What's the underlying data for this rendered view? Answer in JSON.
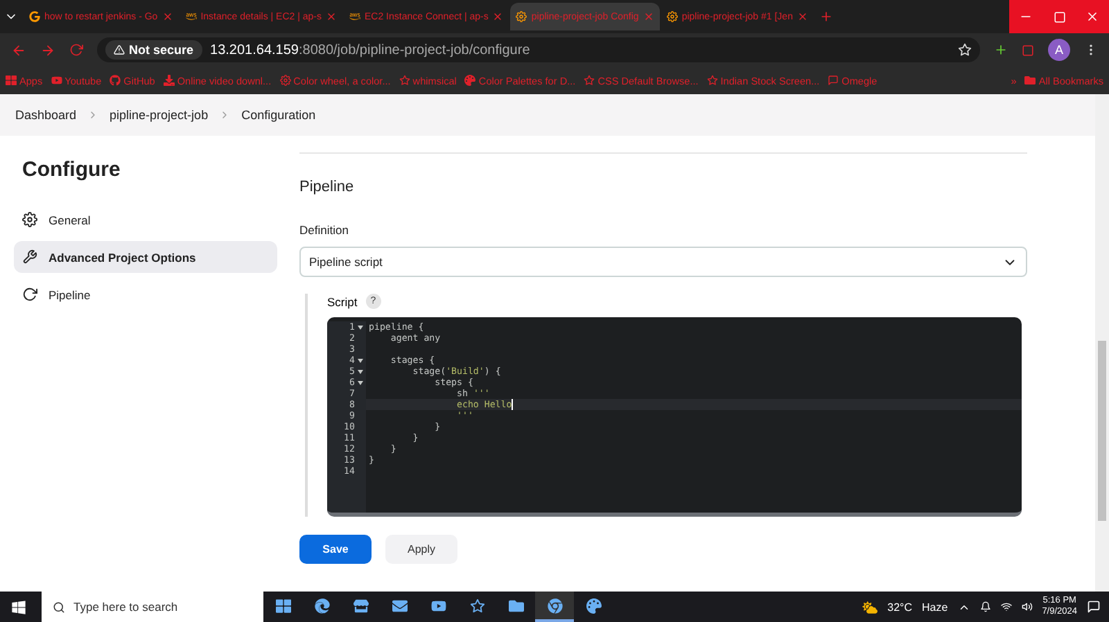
{
  "browser": {
    "tabs": [
      {
        "title": "how to restart jenkins - Go",
        "selected": false
      },
      {
        "title": "Instance details | EC2 | ap-s",
        "selected": false
      },
      {
        "title": "EC2 Instance Connect | ap-s",
        "selected": false
      },
      {
        "title": "pipline-project-job Config",
        "selected": true
      },
      {
        "title": "pipline-project-job #1 [Jen",
        "selected": false
      }
    ],
    "security": "Not secure",
    "url_host": "13.201.64.159",
    "url_path": ":8080/job/pipline-project-job/configure",
    "profile": "A",
    "bookmarks": [
      "Apps",
      "Youtube",
      "GitHub",
      "Online video downl...",
      "Color wheel, a color...",
      "whimsical",
      "Color Palettes for D...",
      "CSS Default Browse...",
      "Indian Stock Screen...",
      "Omegle"
    ],
    "more": "»",
    "all_bookmarks": "All Bookmarks"
  },
  "breadcrumb": [
    "Dashboard",
    "pipline-project-job",
    "Configuration"
  ],
  "sidebar": {
    "title": "Configure",
    "items": [
      {
        "label": "General",
        "selected": false
      },
      {
        "label": "Advanced Project Options",
        "selected": true
      },
      {
        "label": "Pipeline",
        "selected": false
      }
    ]
  },
  "section": {
    "title": "Pipeline",
    "definition_label": "Definition",
    "definition_value": "Pipeline script",
    "script_label": "Script",
    "help": "?",
    "code": [
      {
        "number": "1",
        "foldable": true,
        "active": false,
        "segments": [
          {
            "text": "pipeline {",
            "kind": "plain"
          }
        ]
      },
      {
        "number": "2",
        "foldable": false,
        "active": false,
        "segments": [
          {
            "text": "    agent any",
            "kind": "plain"
          }
        ]
      },
      {
        "number": "3",
        "foldable": false,
        "active": false
      },
      {
        "number": "4",
        "foldable": true,
        "active": false,
        "segments": [
          {
            "text": "    stages {",
            "kind": "plain"
          }
        ]
      },
      {
        "number": "5",
        "foldable": true,
        "active": false,
        "segments": [
          {
            "text": "        stage(",
            "kind": "plain"
          },
          {
            "text": "'Build'",
            "kind": "string"
          },
          {
            "text": ") {",
            "kind": "plain"
          }
        ]
      },
      {
        "number": "6",
        "foldable": true,
        "active": false,
        "segments": [
          {
            "text": "            steps {",
            "kind": "plain"
          }
        ]
      },
      {
        "number": "7",
        "foldable": false,
        "active": false,
        "segments": [
          {
            "text": "                sh ",
            "kind": "plain"
          },
          {
            "text": "'''",
            "kind": "string"
          }
        ]
      },
      {
        "number": "8",
        "foldable": false,
        "active": true,
        "segments": [
          {
            "text": "                echo Hello",
            "kind": "string"
          }
        ]
      },
      {
        "number": "9",
        "foldable": false,
        "active": false,
        "segments": [
          {
            "text": "                '''",
            "kind": "string"
          }
        ]
      },
      {
        "number": "10",
        "foldable": false,
        "active": false,
        "segments": [
          {
            "text": "            }",
            "kind": "plain"
          }
        ]
      },
      {
        "number": "11",
        "foldable": false,
        "active": false,
        "segments": [
          {
            "text": "        }",
            "kind": "plain"
          }
        ]
      },
      {
        "number": "12",
        "foldable": false,
        "active": false,
        "segments": [
          {
            "text": "    }",
            "kind": "plain"
          }
        ]
      },
      {
        "number": "13",
        "foldable": false,
        "active": false,
        "segments": [
          {
            "text": "}",
            "kind": "plain"
          }
        ]
      },
      {
        "number": "14",
        "foldable": false,
        "active": false
      }
    ]
  },
  "buttons": [
    {
      "label": "Save",
      "kind": "primary"
    },
    {
      "label": "Apply",
      "kind": "secondary"
    }
  ],
  "taskbar": {
    "search_placeholder": "Type here to search",
    "apps": [
      {
        "selected": false
      },
      {
        "selected": false
      },
      {
        "selected": false
      },
      {
        "selected": false
      },
      {
        "selected": false
      },
      {
        "selected": false
      },
      {
        "selected": false
      },
      {
        "selected": true
      },
      {
        "selected": false
      }
    ],
    "temperature": "32°C",
    "weather": "Haze",
    "time": "5:16 PM",
    "date": "7/9/2024"
  }
}
